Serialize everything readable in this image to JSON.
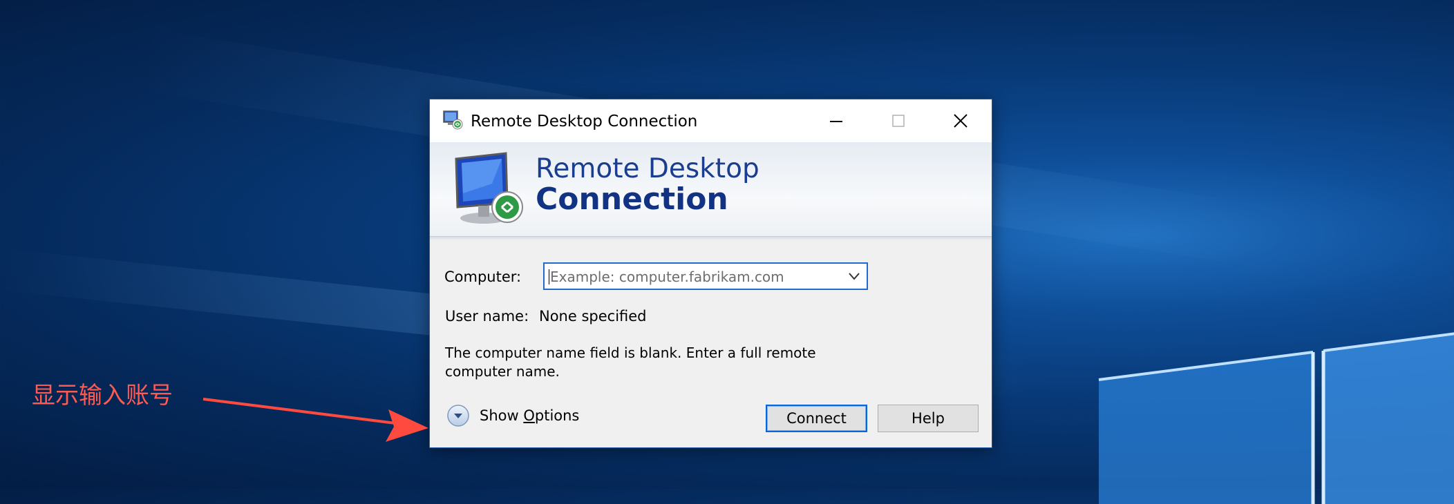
{
  "desktop": {
    "background_color": "#0b4a91"
  },
  "dialog": {
    "title": "Remote Desktop Connection",
    "banner_line1": "Remote Desktop",
    "banner_line2": "Connection",
    "computer_label": "Computer:",
    "computer_placeholder": "Example: computer.fabrikam.com",
    "computer_value": "",
    "username_label": "User name:",
    "username_value": "None specified",
    "message": "The computer name field is blank. Enter a full remote computer name.",
    "show_options_prefix": "Show ",
    "show_options_accel": "O",
    "show_options_suffix": "ptions",
    "connect_label": "Connect",
    "help_label": "Help",
    "accent_color": "#0a66d8",
    "banner_text_color": "#123383"
  },
  "annotation": {
    "text": "显示输入账号",
    "color": "#ff5a52"
  }
}
